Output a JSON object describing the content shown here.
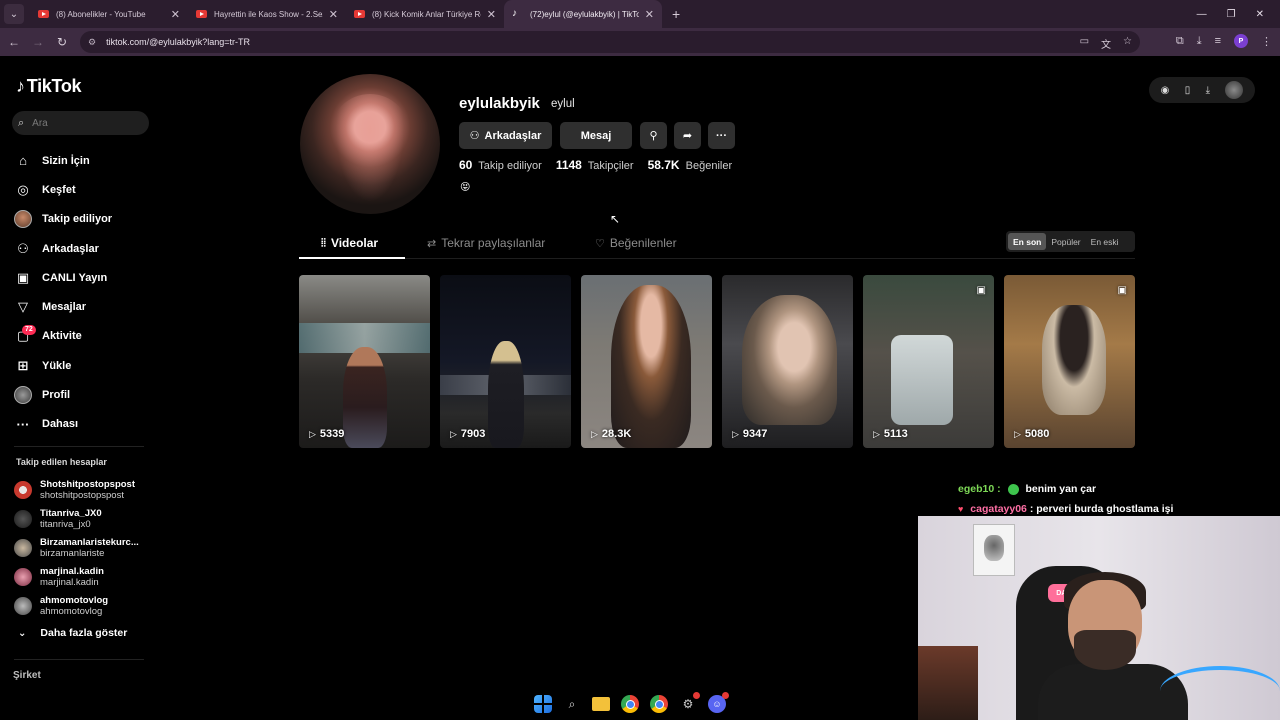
{
  "browser": {
    "tabs": [
      {
        "title": "(8) Abonelikler - YouTube",
        "type": "youtube"
      },
      {
        "title": "Hayrettin ile Kaos Show - 2.Sez",
        "type": "youtube"
      },
      {
        "title": "(8) Kick Komik Anlar Türkiye Re",
        "type": "youtube"
      },
      {
        "title": "(72)eylul (@eylulakbyik) | TikTok",
        "type": "tiktok",
        "active": true
      }
    ],
    "url": "tiktok.com/@eylulakbyik?lang=tr-TR",
    "profile_initial": "P"
  },
  "sidebar": {
    "logo": "TikTok",
    "search_placeholder": "Ara",
    "nav": [
      {
        "label": "Sizin İçin",
        "icon": "home-icon",
        "glyph": "⌂"
      },
      {
        "label": "Keşfet",
        "icon": "compass-icon",
        "glyph": "◎"
      },
      {
        "label": "Takip ediliyor",
        "icon": "following-avatar",
        "glyph": ""
      },
      {
        "label": "Arkadaşlar",
        "icon": "friends-icon",
        "glyph": "⚇"
      },
      {
        "label": "CANLI Yayın",
        "icon": "live-icon",
        "glyph": "▣"
      },
      {
        "label": "Mesajlar",
        "icon": "messages-icon",
        "glyph": "▽"
      },
      {
        "label": "Aktivite",
        "icon": "activity-icon",
        "glyph": "▢",
        "badge": "72"
      },
      {
        "label": "Yükle",
        "icon": "upload-icon",
        "glyph": "⊞"
      },
      {
        "label": "Profil",
        "icon": "profile-avatar",
        "glyph": ""
      },
      {
        "label": "Dahası",
        "icon": "more-icon",
        "glyph": "···"
      }
    ],
    "following_title": "Takip edilen hesaplar",
    "following": [
      {
        "name": "Shotshitpostopspost",
        "handle": "shotshitpostopspost",
        "color": "#c7392e"
      },
      {
        "name": "Titanriva_JX0",
        "handle": "titanriva_jx0",
        "color": "#2b2b2b"
      },
      {
        "name": "Birzamanlaristekurc...",
        "handle": "birzamanlariste",
        "color": "#6d6d6d"
      },
      {
        "name": "marjinal.kadin",
        "handle": "marjinal.kadin",
        "color": "#b04860"
      },
      {
        "name": "ahmomotovlog",
        "handle": "ahmomotovlog",
        "color": "#777777"
      }
    ],
    "show_more": "Daha fazla göster",
    "company": "Şirket"
  },
  "profile": {
    "username": "eylulakbyik",
    "nickname": "eylul",
    "btn_friends": "Arkadaşlar",
    "btn_message": "Mesaj",
    "stats": [
      {
        "value": "60",
        "label": "Takip ediliyor"
      },
      {
        "value": "1148",
        "label": "Takipçiler"
      },
      {
        "value": "58.7K",
        "label": "Beğeniler"
      }
    ],
    "bio": "😝"
  },
  "tabs": {
    "videos": "Videolar",
    "reposts": "Tekrar paylaşılanlar",
    "liked": "Beğenilenler"
  },
  "sort": [
    "En son",
    "Popüler",
    "En eski"
  ],
  "videos": [
    {
      "views": "5339",
      "photo": false
    },
    {
      "views": "7903",
      "photo": false
    },
    {
      "views": "28.3K",
      "photo": false
    },
    {
      "views": "9347",
      "photo": false
    },
    {
      "views": "5113",
      "photo": true
    },
    {
      "views": "5080",
      "photo": true
    }
  ],
  "chat": [
    {
      "user": "egeb10",
      "sep": ":",
      "message": "benim yan çar"
    },
    {
      "user": "cagatayy06",
      "sep": ":",
      "message": "perveri burda ghostlama işi"
    }
  ],
  "webcam": {
    "chair_logo": "DAWN"
  }
}
